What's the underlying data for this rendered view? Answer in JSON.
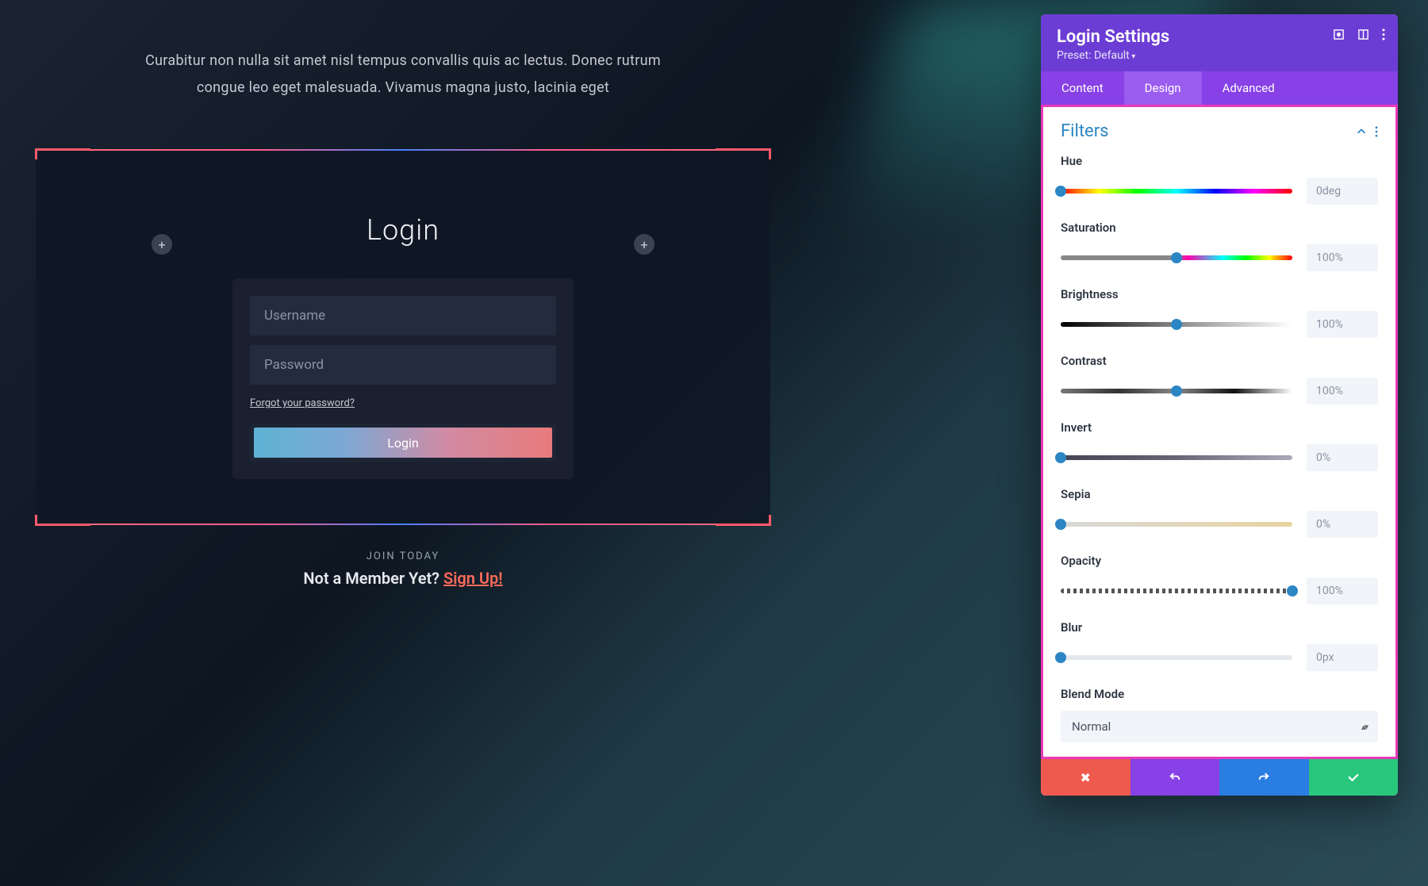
{
  "intro": "Curabitur non nulla sit amet nisl tempus convallis quis ac lectus. Donec rutrum congue leo eget malesuada. Vivamus magna justo, lacinia eget",
  "login": {
    "title": "Login",
    "username_placeholder": "Username",
    "password_placeholder": "Password",
    "forgot": "Forgot your password?",
    "button": "Login"
  },
  "cta": {
    "upper": "Join Today",
    "text": "Not a Member Yet? ",
    "link": "Sign Up!"
  },
  "panel": {
    "title": "Login Settings",
    "preset_label": "Preset: ",
    "preset_value": "Default",
    "tabs": {
      "content": "Content",
      "design": "Design",
      "advanced": "Advanced"
    },
    "active_tab": "Design",
    "section": "Filters",
    "controls": {
      "hue": {
        "label": "Hue",
        "value": "0deg",
        "thumb_pct": 0
      },
      "saturation": {
        "label": "Saturation",
        "value": "100%",
        "thumb_pct": 50
      },
      "brightness": {
        "label": "Brightness",
        "value": "100%",
        "thumb_pct": 50
      },
      "contrast": {
        "label": "Contrast",
        "value": "100%",
        "thumb_pct": 50
      },
      "invert": {
        "label": "Invert",
        "value": "0%",
        "thumb_pct": 0
      },
      "sepia": {
        "label": "Sepia",
        "value": "0%",
        "thumb_pct": 0
      },
      "opacity": {
        "label": "Opacity",
        "value": "100%",
        "thumb_pct": 100
      },
      "blur": {
        "label": "Blur",
        "value": "0px",
        "thumb_pct": 0
      }
    },
    "blend_mode": {
      "label": "Blend Mode",
      "value": "Normal"
    }
  }
}
